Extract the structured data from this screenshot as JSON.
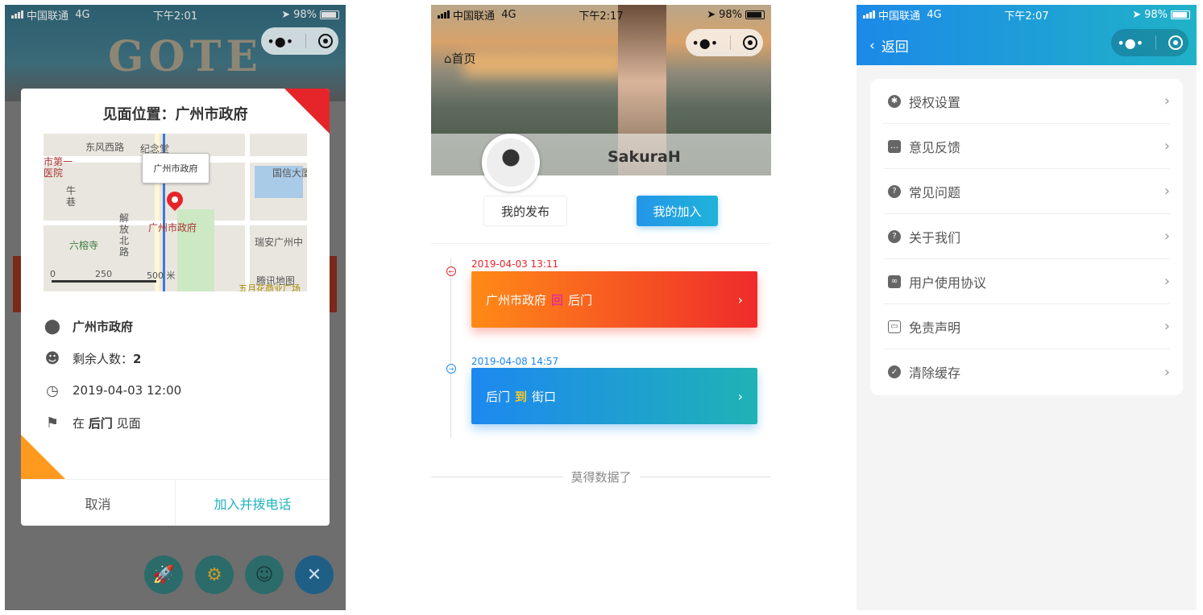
{
  "status_bars": [
    {
      "carrier": "中国联通",
      "network": "4G",
      "time": "下午2:01",
      "battery": "98%"
    },
    {
      "carrier": "中国联通",
      "network": "4G",
      "time": "下午2:17",
      "battery": "98%"
    },
    {
      "carrier": "中国联通",
      "network": "4G",
      "time": "下午2:07",
      "battery": "98%"
    }
  ],
  "capsule": {
    "more": "•●•"
  },
  "panel1": {
    "logo_text": "GOTE",
    "modal": {
      "title": "见面位置：广州市政府",
      "map": {
        "tooltip": "广州市政府",
        "labels": [
          "东风西路",
          "纪念堂",
          "市第一",
          "医院",
          "牛",
          "巷",
          "解",
          "放",
          "北",
          "路",
          "六榕寺",
          "广州市政府",
          "国信大厦",
          "瑞安广州中",
          "0",
          "250",
          "500 米",
          "腾讯地图",
          "五月花商业广场"
        ]
      },
      "place": "广州市政府",
      "remaining_label": "剩余人数：",
      "remaining_value": "2",
      "datetime": "2019-04-03 12:00",
      "meet_prefix": "在",
      "meet_place": "后门",
      "meet_suffix": "见面",
      "cancel": "取消",
      "join": "加入并拨电话"
    }
  },
  "panel2": {
    "home": "首页",
    "username": "SakuraH",
    "tabs": [
      "我的发布",
      "我的加入"
    ],
    "timeline": [
      {
        "date": "2019-04-03 13:11",
        "from": "广州市政府",
        "connector": "回",
        "to": "后门",
        "color": "#e5252a"
      },
      {
        "date": "2019-04-08 14:57",
        "from": "后门",
        "connector": "到",
        "to": "街口",
        "color": "#1d88f0"
      }
    ],
    "no_more": "莫得数据了"
  },
  "panel3": {
    "back": "返回",
    "items": [
      "授权设置",
      "意见反馈",
      "常见问题",
      "关于我们",
      "用户使用协议",
      "免责声明",
      "清除缓存"
    ]
  }
}
